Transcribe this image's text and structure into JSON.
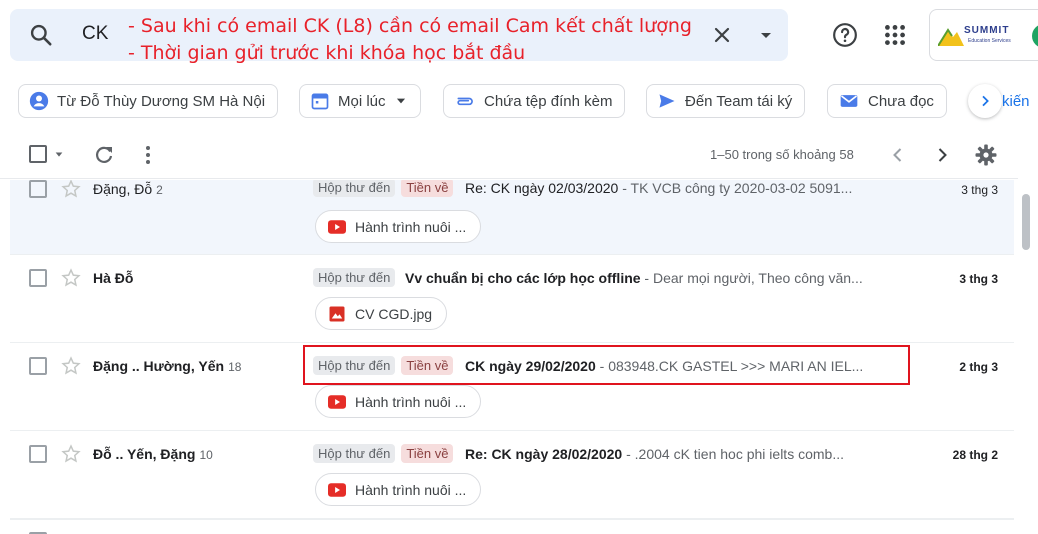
{
  "search": {
    "query": "CK",
    "note_lines": [
      "- Sau khi có email CK (L8) cần có email Cam kết chất lượng",
      "- Thời gian gửi trước khi khóa học bắt đầu"
    ]
  },
  "account": {
    "logo_text": "SUMMIT",
    "logo_sub": "Education Services"
  },
  "chips": [
    {
      "label": "Từ Đỗ Thùy Dương SM Hà Nội",
      "icon": "person-icon"
    },
    {
      "label": "Mọi lúc",
      "icon": "calendar-icon",
      "dropdown": true
    },
    {
      "label": "Chứa tệp đính kèm",
      "icon": "paperclip-icon"
    },
    {
      "label": "Đến Team tái ký",
      "icon": "send-icon"
    },
    {
      "label": "Chưa đọc",
      "icon": "mail-icon"
    }
  ],
  "chips_overflow": "kiến",
  "toolbar": {
    "pagination": "1–50 trong số khoảng 58"
  },
  "emails": [
    {
      "sender": "Đặng, Đỗ",
      "count": "2",
      "unread": false,
      "labels": [
        "Hộp thư đến",
        "Tiền về"
      ],
      "subject": "Re: CK ngày 02/03/2020",
      "snippet": " - TK VCB công ty 2020-03-02 5091...",
      "date": "3 thg 3",
      "attachment": {
        "name": "Hành trình nuôi ...",
        "type": "youtube"
      }
    },
    {
      "sender": "Hà Đỗ",
      "count": "",
      "unread": true,
      "labels": [
        "Hộp thư đến"
      ],
      "subject": "Vv chuẩn bị cho các lớp học offline",
      "snippet": " - Dear mọi người, Theo công văn...",
      "date": "3 thg 3",
      "attachment": {
        "name": "CV CGD.jpg",
        "type": "image"
      }
    },
    {
      "sender": "Đặng .. Hường, Yến",
      "count": "18",
      "unread": true,
      "labels": [
        "Hộp thư đến",
        "Tiền về"
      ],
      "subject": "CK ngày 29/02/2020",
      "snippet": " - 083948.CK GASTEL >>> MARI AN IEL...",
      "date": "2 thg 3",
      "attachment": {
        "name": "Hành trình nuôi ...",
        "type": "youtube"
      }
    },
    {
      "sender": "Đỗ .. Yến, Đặng",
      "count": "10",
      "unread": true,
      "labels": [
        "Hộp thư đến",
        "Tiền về"
      ],
      "subject": "Re: CK ngày 28/02/2020",
      "snippet": " - .2004 cK tien hoc phi ielts comb...",
      "date": "28 thg 2",
      "attachment": {
        "name": "Hành trình nuôi ...",
        "type": "youtube"
      }
    }
  ],
  "colors": {
    "annotation": "#e8212a",
    "highlight_box": "#e0141e",
    "accent": "#1a73e8",
    "read_row": "#f2f6fc"
  }
}
